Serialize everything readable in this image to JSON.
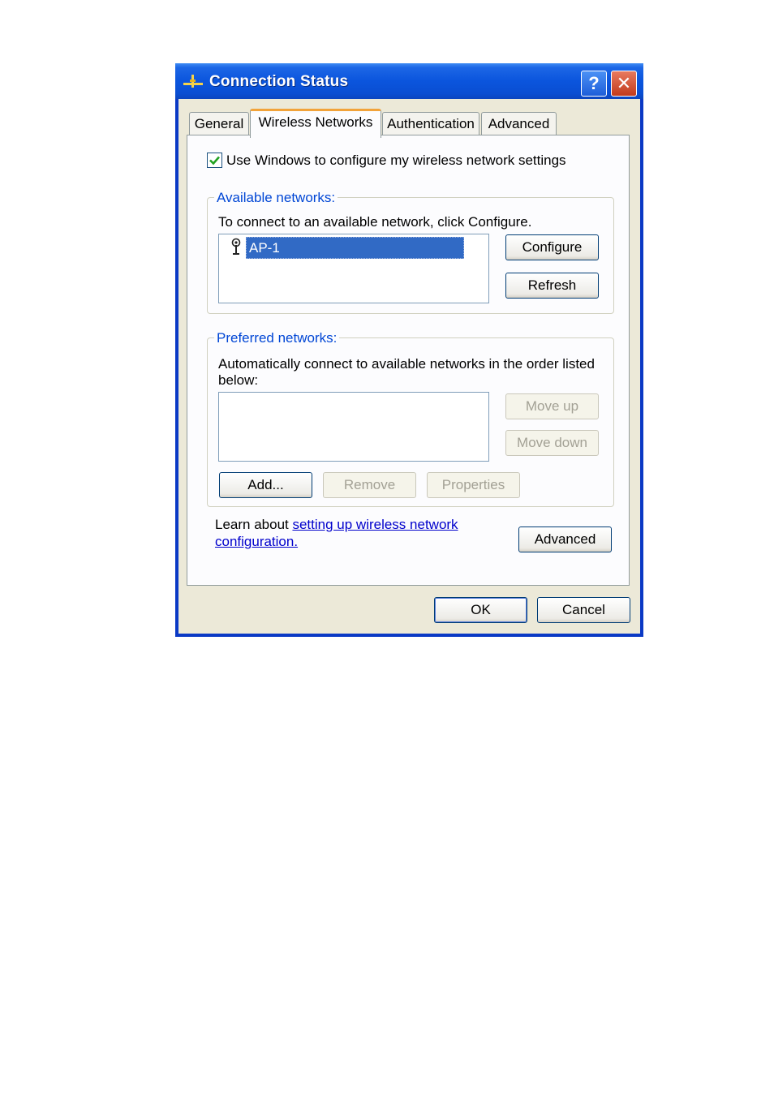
{
  "window": {
    "title": "Connection Status",
    "help_label": "?",
    "close_label": "✕"
  },
  "tabs": [
    {
      "label": "General",
      "active": false
    },
    {
      "label": "Wireless Networks",
      "active": true
    },
    {
      "label": "Authentication",
      "active": false
    },
    {
      "label": "Advanced",
      "active": false
    }
  ],
  "wireless": {
    "use_windows_checked": true,
    "use_windows_label": "Use Windows to configure my wireless network settings",
    "available": {
      "legend": "Available networks:",
      "instruction": "To connect to an available network, click Configure.",
      "networks": [
        "AP-1"
      ],
      "configure_label": "Configure",
      "refresh_label": "Refresh"
    },
    "preferred": {
      "legend": "Preferred networks:",
      "instruction_line1": "Automatically connect to available networks in the order listed",
      "instruction_line2": "below:",
      "move_up_label": "Move up",
      "move_down_label": "Move down",
      "add_label": "Add...",
      "remove_label": "Remove",
      "properties_label": "Properties"
    },
    "learn_prefix": "Learn about ",
    "learn_link_line1": "setting up wireless network",
    "learn_link_line2": "configuration.",
    "advanced_label": "Advanced"
  },
  "footer": {
    "ok_label": "OK",
    "cancel_label": "Cancel"
  },
  "colors": {
    "title_bar": "#0B55DD",
    "dialog_face": "#ECE9D8",
    "group_legend": "#0046D5",
    "selection": "#316AC5",
    "active_tab_accent": "#F2A33A"
  }
}
